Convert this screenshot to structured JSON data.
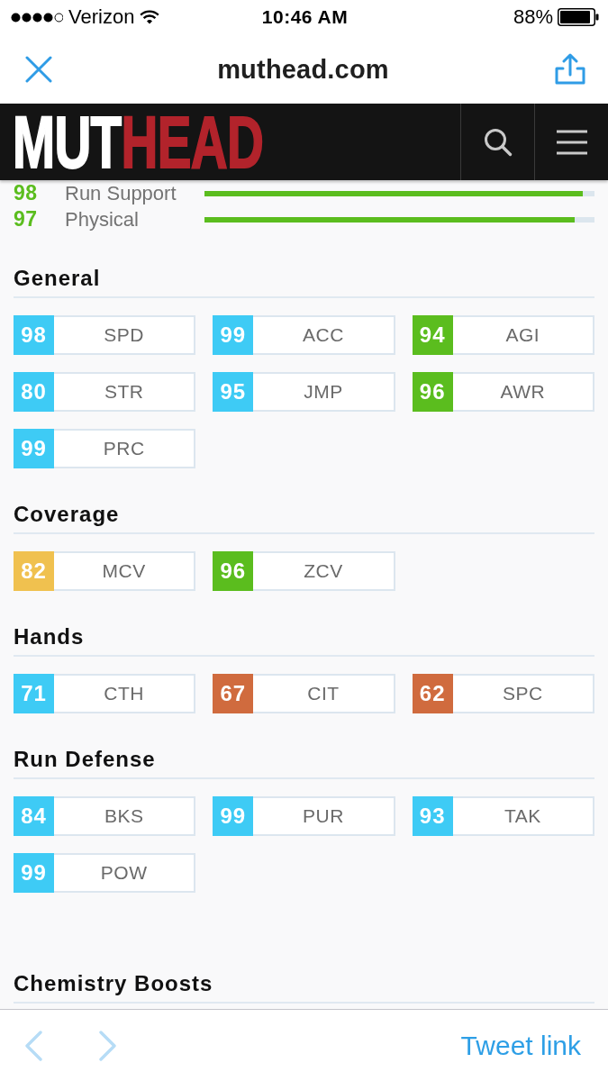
{
  "status_bar": {
    "carrier": "Verizon",
    "time": "10:46 AM",
    "battery": "88%"
  },
  "browser_bar": {
    "title": "muthead.com"
  },
  "site_header": {
    "logo": [
      "MUT",
      "HEAD"
    ]
  },
  "ratings": [
    {
      "value": "98",
      "name": "Run Support",
      "level": 0.97,
      "color": "#5bbd1e"
    },
    {
      "value": "97",
      "name": "Physical",
      "level": 0.95,
      "color": "#5bbd1e"
    }
  ],
  "sections": [
    {
      "title": "General",
      "stats": [
        {
          "score": "98",
          "attribute": "SPD",
          "color": "#3ecbf5"
        },
        {
          "score": "99",
          "attribute": "ACC",
          "color": "#3ecbf5"
        },
        {
          "score": "94",
          "attribute": "AGI",
          "color": "#5bbd1e"
        },
        {
          "score": "80",
          "attribute": "STR",
          "color": "#3ecbf5"
        },
        {
          "score": "95",
          "attribute": "JMP",
          "color": "#3ecbf5"
        },
        {
          "score": "96",
          "attribute": "AWR",
          "color": "#5bbd1e"
        },
        {
          "score": "99",
          "attribute": "PRC",
          "color": "#3ecbf5"
        }
      ]
    },
    {
      "title": "Coverage",
      "stats": [
        {
          "score": "82",
          "attribute": "MCV",
          "color": "#f0c14f"
        },
        {
          "score": "96",
          "attribute": "ZCV",
          "color": "#5bbd1e"
        }
      ]
    },
    {
      "title": "Hands",
      "stats": [
        {
          "score": "71",
          "attribute": "CTH",
          "color": "#3ecbf5"
        },
        {
          "score": "67",
          "attribute": "CIT",
          "color": "#d06b3e"
        },
        {
          "score": "62",
          "attribute": "SPC",
          "color": "#d06b3e"
        }
      ]
    },
    {
      "title": "Run Defense",
      "stats": [
        {
          "score": "84",
          "attribute": "BKS",
          "color": "#3ecbf5"
        },
        {
          "score": "99",
          "attribute": "PUR",
          "color": "#3ecbf5"
        },
        {
          "score": "93",
          "attribute": "TAK",
          "color": "#3ecbf5"
        },
        {
          "score": "99",
          "attribute": "POW",
          "color": "#3ecbf5"
        }
      ]
    }
  ],
  "next_section": {
    "title": "Chemistry Boosts"
  },
  "toolbar": {
    "back": {
      "disabled": true
    },
    "forward": {
      "disabled": true
    },
    "action": "Tweet link"
  }
}
